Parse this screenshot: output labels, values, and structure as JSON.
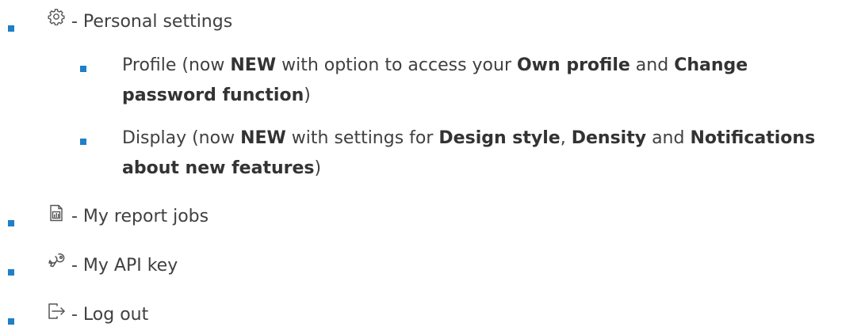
{
  "colors": {
    "bullet": "#1f7fc7",
    "text": "#404040",
    "icon": "#555555"
  },
  "items": [
    {
      "icon": "gear-icon",
      "label": "- Personal settings"
    },
    {
      "icon": "report-document-icon",
      "label": "- My report jobs"
    },
    {
      "icon": "key-icon",
      "label": "- My API key"
    },
    {
      "icon": "logout-icon",
      "label": "- Log out"
    }
  ],
  "sub_items": [
    {
      "parts": [
        "Profile (now ",
        "NEW",
        " with option to access your ",
        "Own profile",
        " and ",
        "Change password function",
        ")"
      ]
    },
    {
      "parts": [
        "Display (now ",
        "NEW",
        " with settings for ",
        "Design style",
        ", ",
        "Density",
        " and ",
        "Notifications about new features",
        ")"
      ]
    }
  ]
}
